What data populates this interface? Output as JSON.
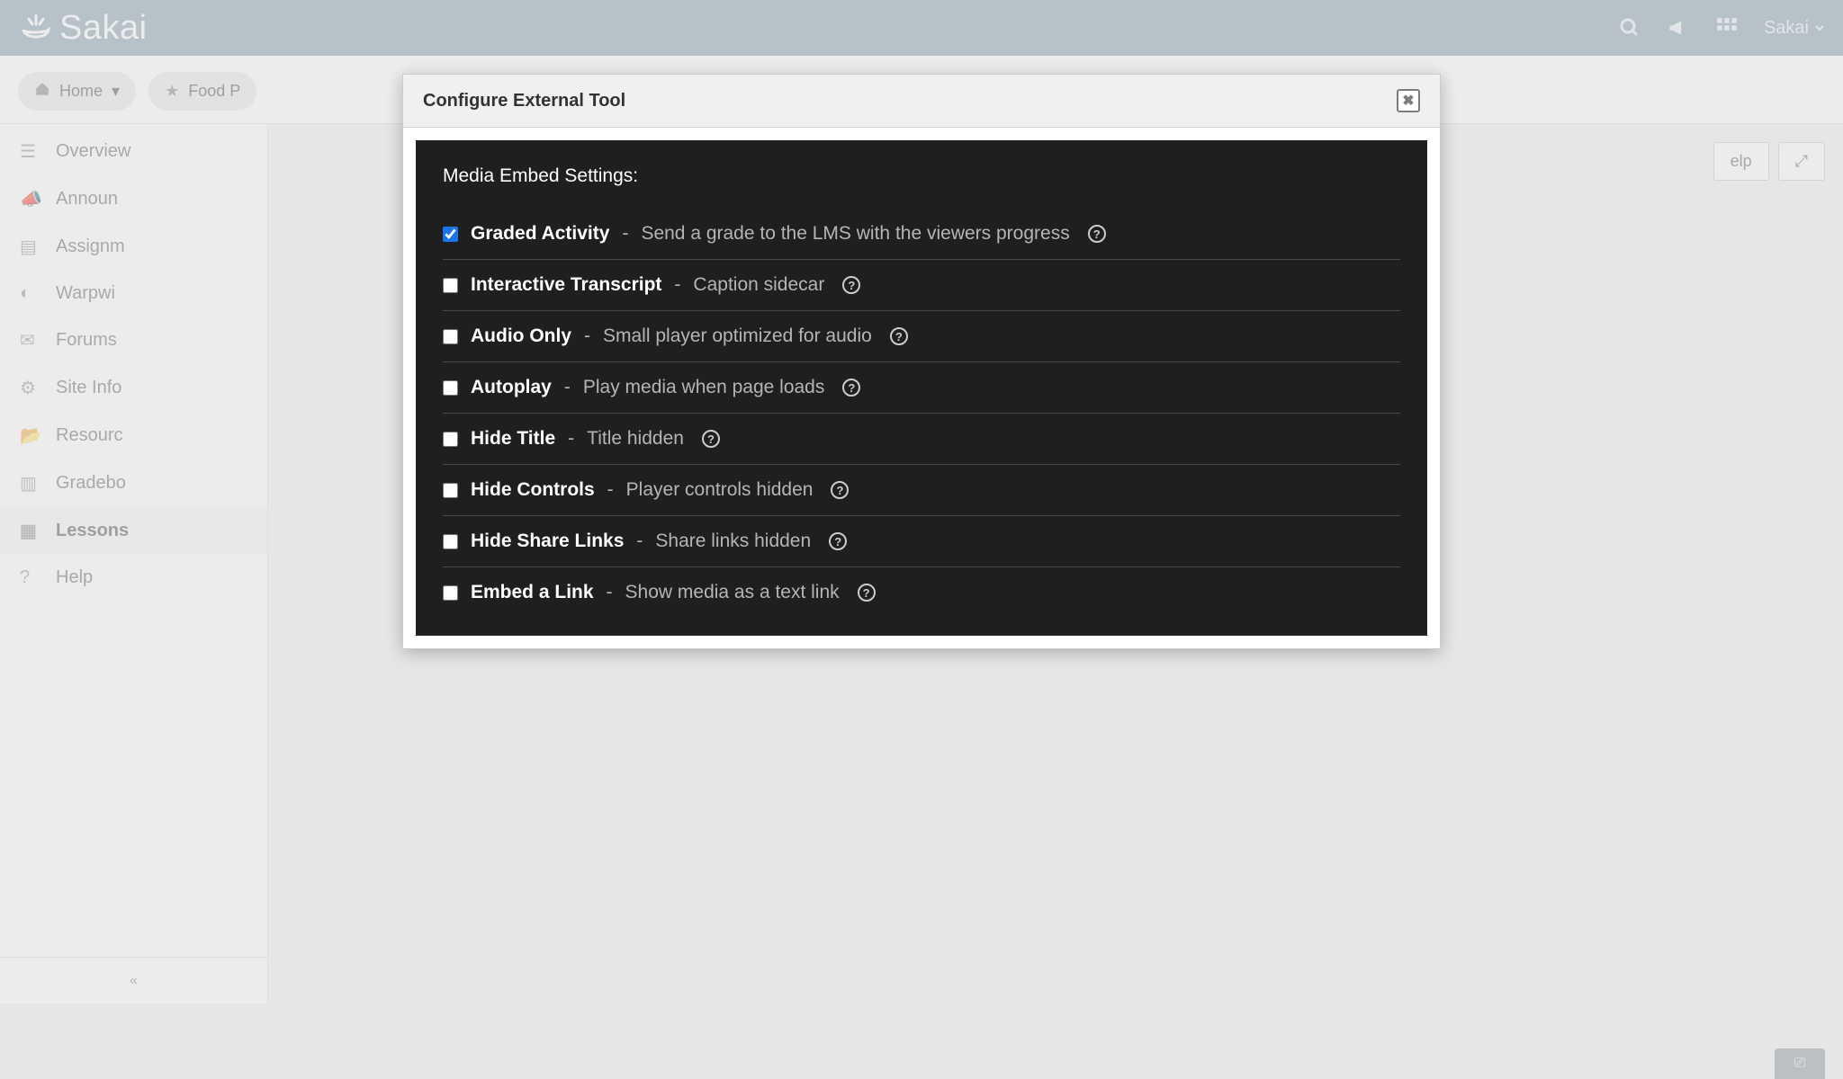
{
  "header": {
    "brand": "Sakai",
    "user_name": "Sakai"
  },
  "subbar": {
    "home_label": "Home",
    "site_label": "Food P"
  },
  "sidebar": {
    "items": [
      {
        "label": "Overview"
      },
      {
        "label": "Announ"
      },
      {
        "label": "Assignm"
      },
      {
        "label": "Warpwi"
      },
      {
        "label": "Forums"
      },
      {
        "label": "Site Info"
      },
      {
        "label": "Resourc"
      },
      {
        "label": "Gradebo"
      },
      {
        "label": "Lessons"
      },
      {
        "label": "Help"
      }
    ]
  },
  "toolbuttons": {
    "help_label": "elp"
  },
  "modal": {
    "title": "Configure External Tool",
    "panel_heading": "Media Embed Settings:",
    "options": [
      {
        "label": "Graded Activity",
        "desc": "Send a grade to the LMS with the viewers progress",
        "checked": true
      },
      {
        "label": "Interactive Transcript",
        "desc": "Caption sidecar",
        "checked": false
      },
      {
        "label": "Audio Only",
        "desc": "Small player optimized for audio",
        "checked": false
      },
      {
        "label": "Autoplay",
        "desc": "Play media when page loads",
        "checked": false
      },
      {
        "label": "Hide Title",
        "desc": "Title hidden",
        "checked": false
      },
      {
        "label": "Hide Controls",
        "desc": "Player controls hidden",
        "checked": false
      },
      {
        "label": "Hide Share Links",
        "desc": "Share links hidden",
        "checked": false
      },
      {
        "label": "Embed a Link",
        "desc": "Show media as a text link",
        "checked": false
      }
    ]
  }
}
